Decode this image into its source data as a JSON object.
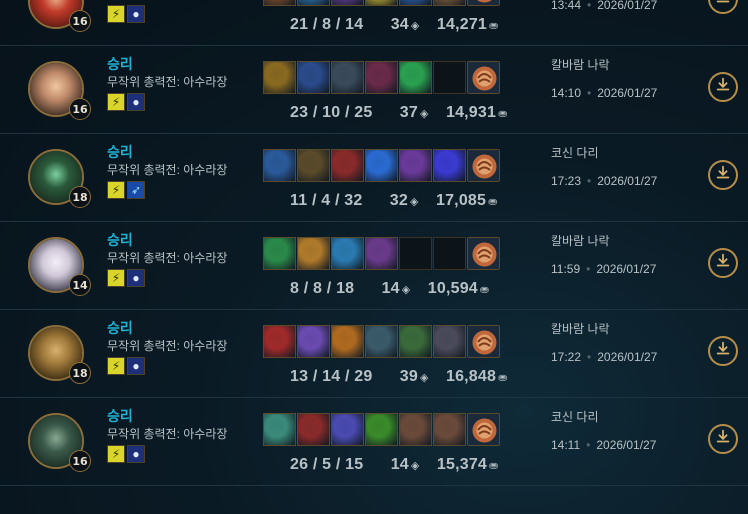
{
  "matches": [
    {
      "result": "",
      "mode": "",
      "level": "16",
      "kills": "21",
      "deaths": "8",
      "assists": "14",
      "cs": "34",
      "gold": "14,271",
      "map": "",
      "time": "13:44",
      "date": "2026/01/27",
      "avatar": [
        "#5a1a12",
        "#c23a2a",
        "#e8b08a"
      ],
      "spells": [
        "flash",
        "ghost"
      ],
      "items": [
        "#7a4a2a",
        "#2a6aa0",
        "#5a3a8a",
        "#b0a030",
        "#2a5aa0",
        "#7a5a3a",
        "ward"
      ]
    },
    {
      "result": "승리",
      "mode": "무작위 총력전: 아수라장",
      "level": "16",
      "kills": "23",
      "deaths": "10",
      "assists": "25",
      "cs": "37",
      "gold": "14,931",
      "map": "칼바람 나락",
      "time": "14:10",
      "date": "2026/01/27",
      "avatar": [
        "#3a2a20",
        "#c08a6a",
        "#f0c8a0"
      ],
      "spells": [
        "flash",
        "ghost"
      ],
      "items": [
        "#8a6a20",
        "#2a4a8a",
        "#3a4a5a",
        "#6a2a4a",
        "#2aa050",
        "empty",
        "ward"
      ]
    },
    {
      "result": "승리",
      "mode": "무작위 총력전: 아수라장",
      "level": "18",
      "kills": "11",
      "deaths": "4",
      "assists": "32",
      "cs": "32",
      "gold": "17,085",
      "map": "코신 다리",
      "time": "17:23",
      "date": "2026/01/27",
      "avatar": [
        "#1a2a20",
        "#2a5a3a",
        "#7ad0a0"
      ],
      "spells": [
        "flash",
        "dash"
      ],
      "items": [
        "#2a5a9a",
        "#5a4a2a",
        "#8a2a2a",
        "#2a6ad0",
        "#6a3a9a",
        "#3a3ad0",
        "ward"
      ]
    },
    {
      "result": "승리",
      "mode": "무작위 총력전: 아수라장",
      "level": "14",
      "kills": "8",
      "deaths": "8",
      "assists": "18",
      "cs": "14",
      "gold": "10,594",
      "map": "칼바람 나락",
      "time": "11:59",
      "date": "2026/01/27",
      "avatar": [
        "#3a3a4a",
        "#d0c8d8",
        "#f4eef8"
      ],
      "spells": [
        "flash",
        "ghost"
      ],
      "items": [
        "#2a8a4a",
        "#b07a2a",
        "#2a7ab0",
        "#6a3a8a",
        "empty",
        "empty",
        "ward"
      ]
    },
    {
      "result": "승리",
      "mode": "무작위 총력전: 아수라장",
      "level": "18",
      "kills": "13",
      "deaths": "14",
      "assists": "29",
      "cs": "39",
      "gold": "16,848",
      "map": "칼바람 나락",
      "time": "17:22",
      "date": "2026/01/27",
      "avatar": [
        "#3a2a10",
        "#a07a3a",
        "#d8b070"
      ],
      "spells": [
        "flash",
        "ghost"
      ],
      "items": [
        "#a02a2a",
        "#6a4ab0",
        "#b06a20",
        "#3a5a6a",
        "#3a6a3a",
        "#4a4a5a",
        "ward"
      ]
    },
    {
      "result": "승리",
      "mode": "무작위 총력전: 아수라장",
      "level": "16",
      "kills": "26",
      "deaths": "5",
      "assists": "15",
      "cs": "14",
      "gold": "15,374",
      "map": "코신 다리",
      "time": "14:11",
      "date": "2026/01/27",
      "avatar": [
        "#1a2a22",
        "#3a5a4a",
        "#8aa890"
      ],
      "spells": [
        "flash",
        "ghost"
      ],
      "items": [
        "#3a8a7a",
        "#8a2a2a",
        "#4a4ab0",
        "#3a8a2a",
        "#6a4a3a",
        "#6a4a3a",
        "ward"
      ]
    }
  ]
}
